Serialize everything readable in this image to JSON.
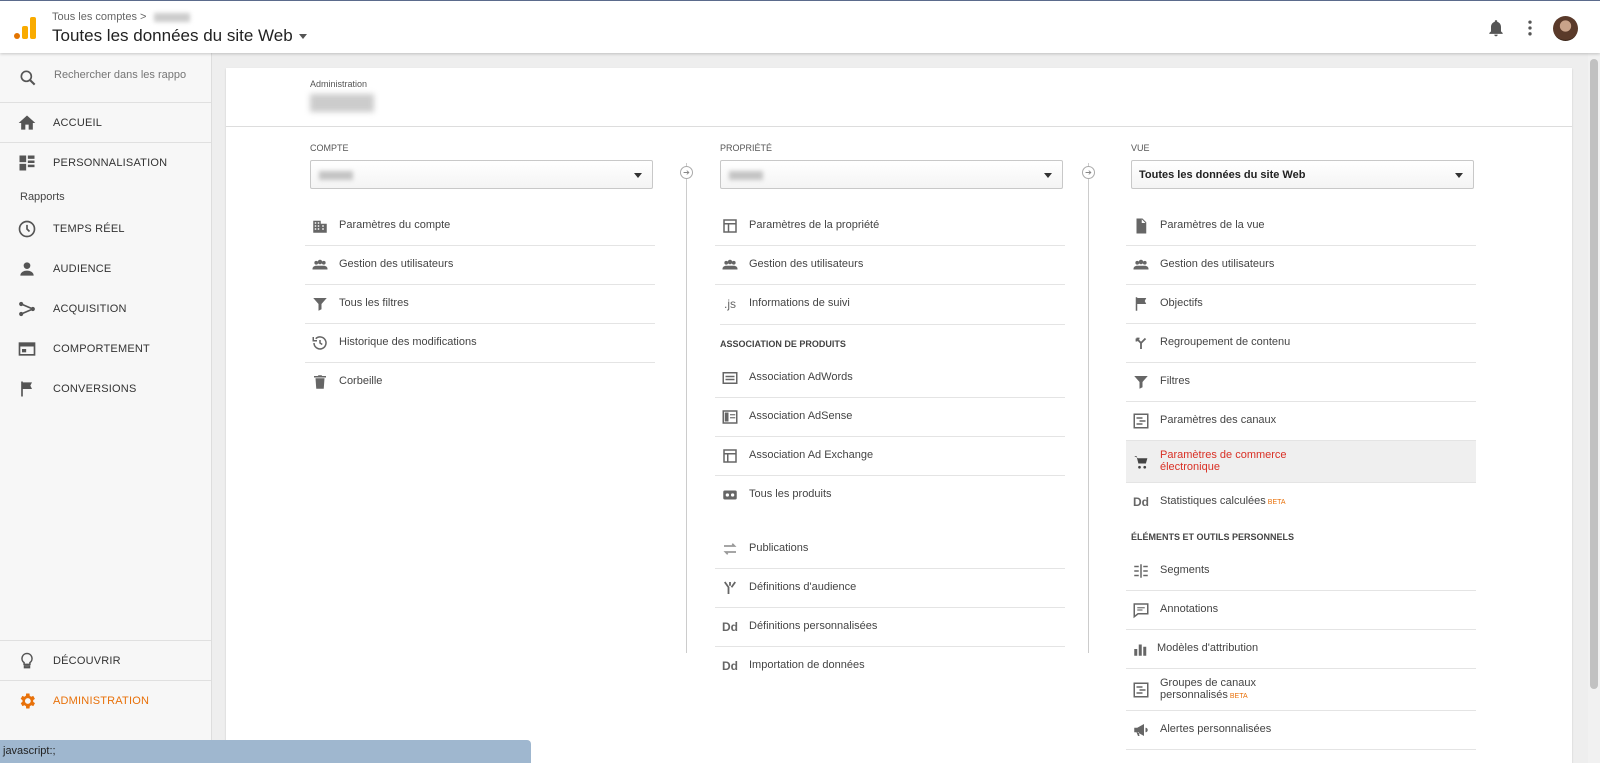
{
  "header": {
    "breadcrumb_root": "Tous les comptes",
    "breadcrumb_sep": ">",
    "view_title": "Toutes les données du site Web"
  },
  "sidebar": {
    "search_placeholder": "Rechercher dans les rapports",
    "top_items": [
      {
        "label": "ACCUEIL",
        "icon": "home-icon"
      },
      {
        "label": "PERSONNALISATION",
        "icon": "dashboard-icon"
      }
    ],
    "section_label": "Rapports",
    "report_items": [
      {
        "label": "TEMPS RÉEL",
        "icon": "clock-icon"
      },
      {
        "label": "AUDIENCE",
        "icon": "person-icon"
      },
      {
        "label": "ACQUISITION",
        "icon": "acquisition-icon"
      },
      {
        "label": "COMPORTEMENT",
        "icon": "behavior-icon"
      },
      {
        "label": "CONVERSIONS",
        "icon": "flag-icon"
      }
    ],
    "bottom_items": [
      {
        "label": "DÉCOUVRIR",
        "icon": "lightbulb-icon"
      },
      {
        "label": "ADMINISTRATION",
        "icon": "gear-icon"
      }
    ]
  },
  "admin": {
    "title": "Administration",
    "columns": {
      "account": {
        "title": "COMPTE",
        "items": [
          "Paramètres du compte",
          "Gestion des utilisateurs",
          "Tous les filtres",
          "Historique des modifications",
          "Corbeille"
        ]
      },
      "property": {
        "title": "PROPRIÉTÉ",
        "items": [
          "Paramètres de la propriété",
          "Gestion des utilisateurs",
          "Informations de suivi"
        ],
        "section": "ASSOCIATION DE PRODUITS",
        "section_items": [
          "Association AdWords",
          "Association AdSense",
          "Association Ad Exchange",
          "Tous les produits"
        ],
        "extra_items": [
          "Publications",
          "Définitions d'audience",
          "Définitions personnalisées",
          "Importation de données"
        ]
      },
      "view": {
        "title": "VUE",
        "selected": "Toutes les données du site Web",
        "items": [
          "Paramètres de la vue",
          "Gestion des utilisateurs",
          "Objectifs",
          "Regroupement de contenu",
          "Filtres",
          "Paramètres des canaux",
          "Paramètres de commerce électronique",
          "Statistiques calculées"
        ],
        "beta": "BETA",
        "section": "ÉLÉMENTS ET OUTILS PERSONNELS",
        "section_items": [
          "Segments",
          "Annotations",
          "Modèles d'attribution",
          "Groupes de canaux personnalisés",
          "Alertes personnalisées"
        ]
      }
    },
    "js_glyph": ".js",
    "dd_glyph": "Dd"
  },
  "status_bar": "javascript:;",
  "colors": {
    "accent": "#e8710a",
    "highlight_text": "#d93025",
    "logo_orange": "#f9ab00"
  }
}
